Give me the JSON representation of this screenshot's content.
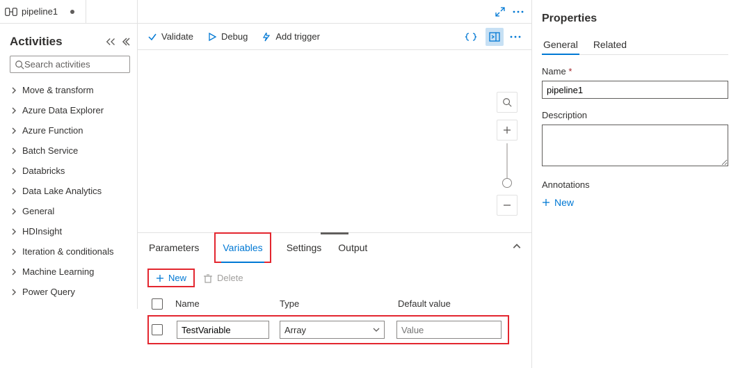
{
  "tab": {
    "title": "pipeline1"
  },
  "sidebar": {
    "heading": "Activities",
    "search_placeholder": "Search activities",
    "items": [
      {
        "label": "Move & transform"
      },
      {
        "label": "Azure Data Explorer"
      },
      {
        "label": "Azure Function"
      },
      {
        "label": "Batch Service"
      },
      {
        "label": "Databricks"
      },
      {
        "label": "Data Lake Analytics"
      },
      {
        "label": "General"
      },
      {
        "label": "HDInsight"
      },
      {
        "label": "Iteration & conditionals"
      },
      {
        "label": "Machine Learning"
      },
      {
        "label": "Power Query"
      }
    ]
  },
  "toolbar": {
    "validate": "Validate",
    "debug": "Debug",
    "add_trigger": "Add trigger"
  },
  "bottom_tabs": {
    "parameters": "Parameters",
    "variables": "Variables",
    "settings": "Settings",
    "output": "Output"
  },
  "actions": {
    "new": "New",
    "delete": "Delete"
  },
  "table": {
    "headers": {
      "name": "Name",
      "type": "Type",
      "default": "Default value"
    },
    "row": {
      "name": "TestVariable",
      "type": "Array",
      "default_placeholder": "Value"
    }
  },
  "properties": {
    "title": "Properties",
    "tabs": {
      "general": "General",
      "related": "Related"
    },
    "name_label": "Name",
    "name_value": "pipeline1",
    "desc_label": "Description",
    "anno_label": "Annotations",
    "anno_new": "New"
  }
}
